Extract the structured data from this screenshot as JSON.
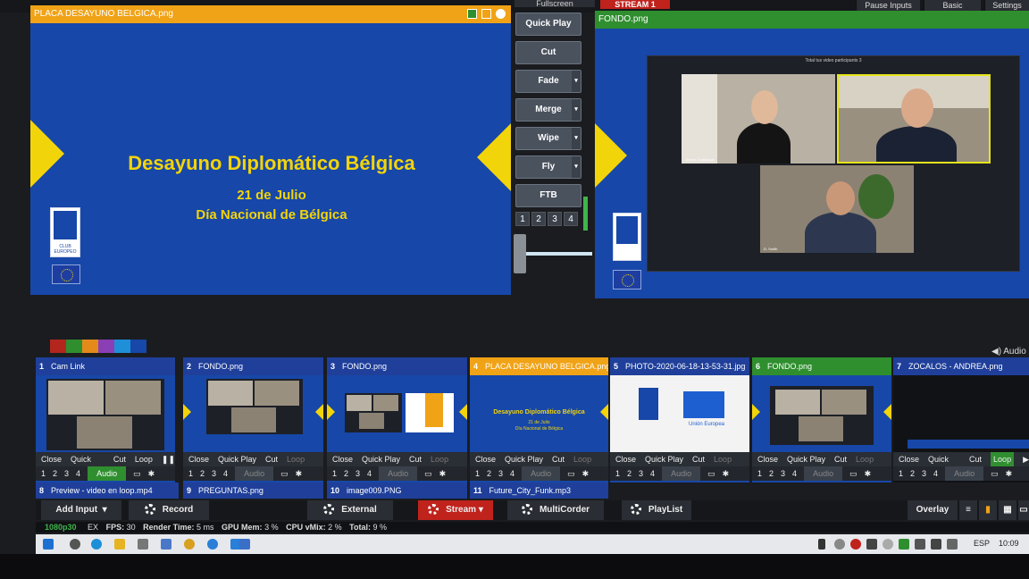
{
  "topbar": {
    "fullscreen_label": "Fullscreen",
    "stream_label": "STREAM 1",
    "pause_inputs": "Pause Inputs",
    "basic": "Basic",
    "settings": "Settings"
  },
  "preview": {
    "title": "PLACA DESAYUNO BELGICA.png",
    "slide_title": "Desayuno Diplomático Bélgica",
    "slide_date": "21 de Julio",
    "slide_subtitle": "Día Nacional de Bélgica",
    "logo_text": "CLUB EUROPEO"
  },
  "output": {
    "title": "FONDO.png",
    "call_header": "Total tus video participants 3",
    "participants": [
      "Jordan Guadalupe",
      "",
      "D. Smith"
    ]
  },
  "transitions": {
    "buttons": [
      "Quick Play",
      "Cut",
      "Fade",
      "Merge",
      "Wipe",
      "Fly",
      "FTB"
    ],
    "numbers": [
      "1",
      "2",
      "3",
      "4"
    ]
  },
  "colors": {
    "swatches": [
      "#b3261e",
      "#2f8f2f",
      "#e38a1a",
      "#8a3fb5",
      "#1f8fd8",
      "#1747a8"
    ],
    "accent_orange": "#f0a316",
    "accent_green": "#2f8f2f",
    "stream_red": "#c0221c",
    "blue_bg": "#1747a8"
  },
  "audio_label": "Audio",
  "inputs": [
    {
      "num": "1",
      "name": "Cam Link",
      "close": "Close",
      "quickplay": "Quick Play",
      "cut": "Cut",
      "loop": "Loop",
      "audio": "Audio"
    },
    {
      "num": "2",
      "name": "FONDO.png",
      "close": "Close",
      "quickplay": "Quick Play",
      "cut": "Cut",
      "loop": "Loop",
      "audio": "Audio"
    },
    {
      "num": "3",
      "name": "FONDO.png",
      "close": "Close",
      "quickplay": "Quick Play",
      "cut": "Cut",
      "loop": "Loop",
      "audio": "Audio"
    },
    {
      "num": "4",
      "name": "PLACA DESAYUNO BELGICA.png",
      "close": "Close",
      "quickplay": "Quick Play",
      "cut": "Cut",
      "loop": "Loop",
      "audio": "Audio",
      "thumb_title": "Desayuno Diplomático Bélgica",
      "thumb_date": "21 de Julio",
      "thumb_sub": "Día Nacional de Bélgica"
    },
    {
      "num": "5",
      "name": "PHOTO-2020-06-18-13-53-31.jpg",
      "close": "Close",
      "quickplay": "Quick Play",
      "cut": "Cut",
      "loop": "Loop",
      "audio": "Audio",
      "thumb_caption": "Unión Europea"
    },
    {
      "num": "6",
      "name": "FONDO.png",
      "close": "Close",
      "quickplay": "Quick Play",
      "cut": "Cut",
      "loop": "Loop",
      "audio": "Audio"
    },
    {
      "num": "7",
      "name": "ZOCALOS - ANDREA.png",
      "close": "Close",
      "quickplay": "Quick Play",
      "cut": "Cut",
      "loop": "Loop",
      "audio": "Audio"
    }
  ],
  "inputs_row2": [
    {
      "num": "8",
      "name": "Preview - video en loop.mp4"
    },
    {
      "num": "9",
      "name": "PREGUNTAS.png"
    },
    {
      "num": "10",
      "name": "image009.PNG"
    },
    {
      "num": "11",
      "name": "Future_City_Funk.mp3"
    }
  ],
  "toolbar": {
    "add_input": "Add Input",
    "record": "Record",
    "external": "External",
    "stream": "Stream",
    "multicorder": "MultiCorder",
    "playlist": "PlayList",
    "overlay": "Overlay"
  },
  "status": {
    "resolution": "1080p30",
    "ex": "EX",
    "fps_label": "FPS:",
    "fps": "30",
    "render_label": "Render Time:",
    "render": "5 ms",
    "gpu_label": "GPU Mem:",
    "gpu": "3 %",
    "cpu_label": "CPU vMix:",
    "cpu": "2 %",
    "total_label": "Total:",
    "total": "9 %"
  },
  "taskbar": {
    "lang": "ESP",
    "time": "10:09"
  }
}
